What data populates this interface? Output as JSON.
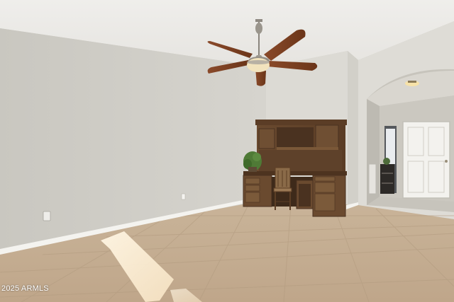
{
  "photo": {
    "watermark": "2025 ARMLS"
  }
}
